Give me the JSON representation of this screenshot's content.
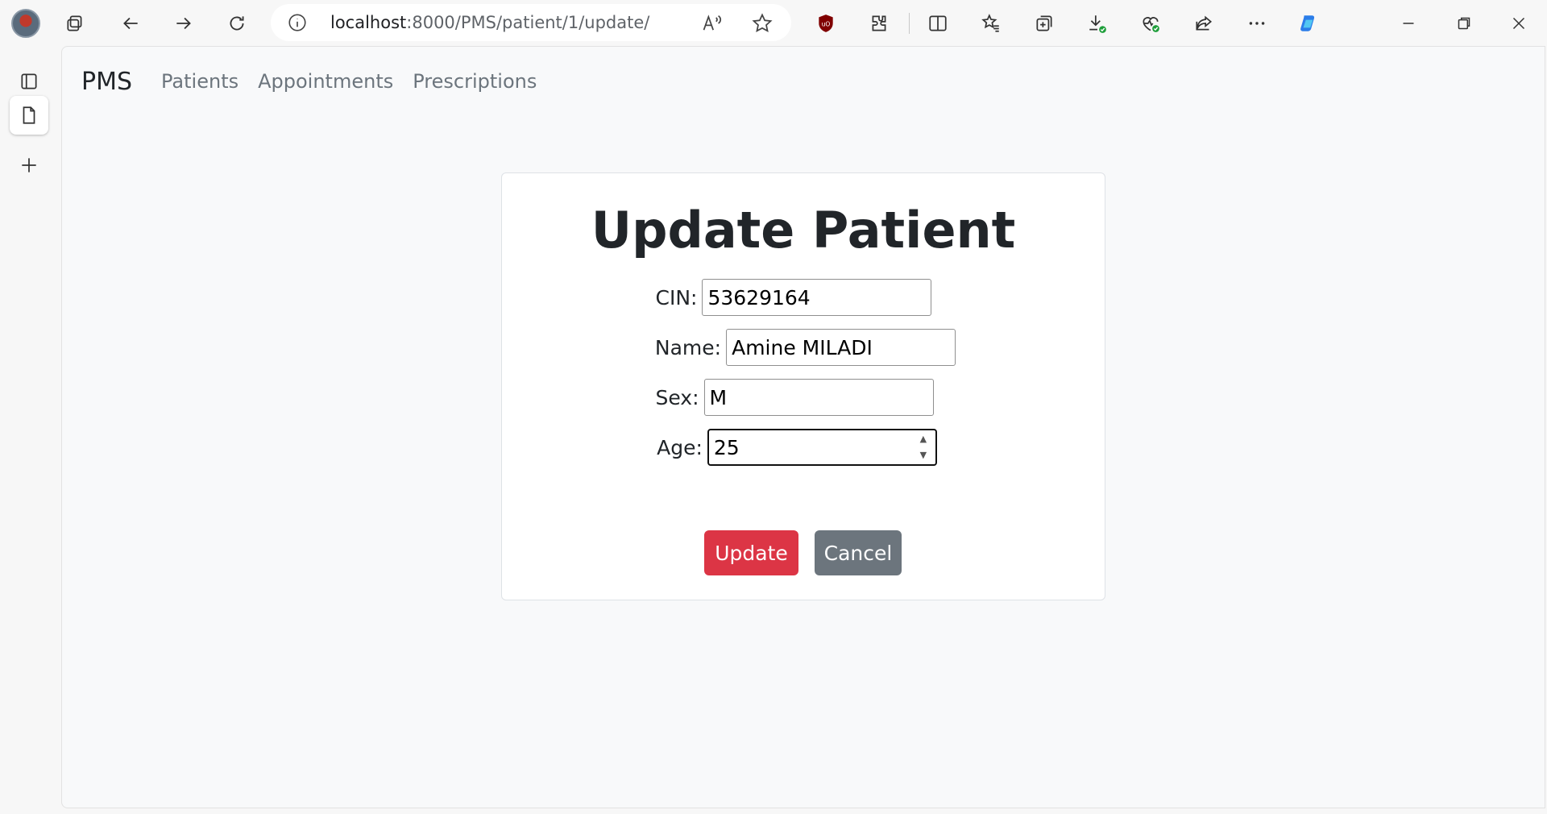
{
  "browser": {
    "url_host": "localhost",
    "url_path": ":8000/PMS/patient/1/update/"
  },
  "navbar": {
    "brand": "PMS",
    "links": [
      "Patients",
      "Appointments",
      "Prescriptions"
    ]
  },
  "form": {
    "title": "Update Patient",
    "fields": [
      {
        "label": "CIN:",
        "value": "53629164"
      },
      {
        "label": "Name:",
        "value": "Amine MILADI"
      },
      {
        "label": "Sex:",
        "value": "M"
      },
      {
        "label": "Age:",
        "value": "25"
      }
    ],
    "update_label": "Update",
    "cancel_label": "Cancel"
  },
  "colors": {
    "update_button": "#dc3545",
    "cancel_button": "#6c757d",
    "ublock_badge": "#800000",
    "copilot": "#2b7de9"
  }
}
